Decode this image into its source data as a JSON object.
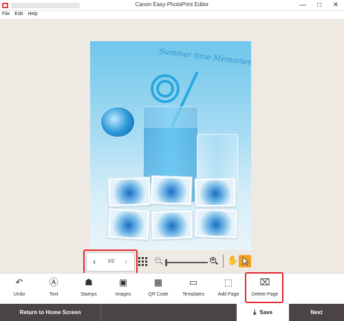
{
  "window": {
    "title": "Canon Easy-PhotoPrint Editor",
    "minimize": "—",
    "maximize": "□",
    "close": "✕"
  },
  "menu": [
    "File",
    "Edit",
    "Help"
  ],
  "photo": {
    "caption": "Summer time Memories"
  },
  "nav": {
    "prev": "‹",
    "next": "›",
    "page_indicator": "2/2"
  },
  "zoom": {
    "level": 0.0
  },
  "view_tools": {
    "hand": "✋"
  },
  "toolbar": [
    {
      "label": "Undo",
      "icon": "undo-icon",
      "glyph": "↶"
    },
    {
      "label": "Text",
      "icon": "text-icon",
      "glyph": "Ⓐ"
    },
    {
      "label": "Stamps",
      "icon": "stamp-icon",
      "glyph": "☗"
    },
    {
      "label": "Images",
      "icon": "image-icon",
      "glyph": "▣"
    },
    {
      "label": "QR Code",
      "icon": "qr-code-icon",
      "glyph": "▦"
    },
    {
      "label": "Templates",
      "icon": "template-icon",
      "glyph": "▭"
    },
    {
      "label": "Add Page",
      "icon": "add-page-icon",
      "glyph": "⬚"
    },
    {
      "label": "Delete Page",
      "icon": "delete-page-icon",
      "glyph": "⌧"
    }
  ],
  "bottom": {
    "return": "Return to Home Screen",
    "save": "Save",
    "save_icon": "⤓",
    "next": "Next"
  },
  "colors": {
    "accent": "#f6a020",
    "highlight": "#e0262e",
    "bottom_bar": "#4a4544"
  }
}
